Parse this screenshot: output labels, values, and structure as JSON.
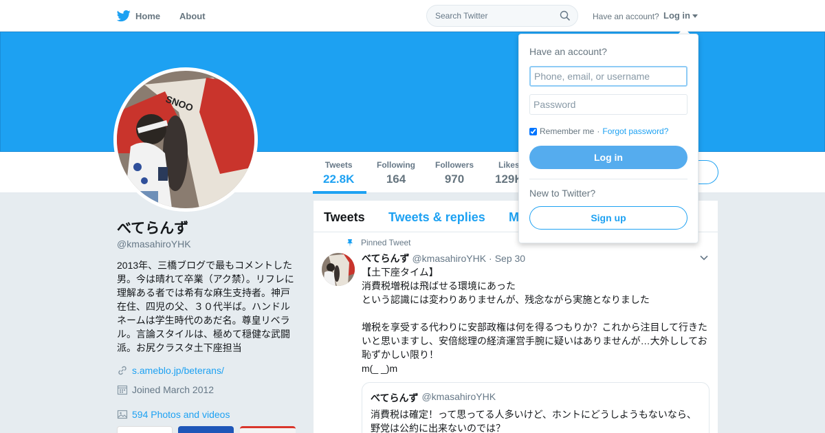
{
  "nav": {
    "home_label": "Home",
    "about_label": "About",
    "search_placeholder": "Search Twitter",
    "have_account": "Have an account?",
    "login_label": "Log in"
  },
  "stats": [
    {
      "label": "Tweets",
      "value": "22.8K"
    },
    {
      "label": "Following",
      "value": "164"
    },
    {
      "label": "Followers",
      "value": "970"
    },
    {
      "label": "Likes",
      "value": "129K"
    }
  ],
  "profile": {
    "name": "べてらんず",
    "handle": "@kmasahiroYHK",
    "bio": "2013年、三橋ブログで最もコメントした男。今は晴れて卒業（アク禁）。リフレに理解ある者では希有な麻生支持者。神戸在住、四児の父、３０代半ば。ハンドルネームは学生時代のあだ名。尊皇リベラル。言論スタイルは、極めて穏健な武闘派。お尻クラスタ土下座担当",
    "link": "s.ameblo.jp/beterans/",
    "joined": "Joined March 2012",
    "photos": "594 Photos and videos"
  },
  "timeline": {
    "tabs": [
      "Tweets",
      "Tweets & replies",
      "M"
    ],
    "pinned_label": "Pinned Tweet",
    "tweet": {
      "name": "べてらんず",
      "handle": "@kmasahiroYHK",
      "separator": "·",
      "date": "Sep 30",
      "text": "【土下座タイム】\n消費税増税は飛ばせる環境にあった\nという認識には変わりありませんが、残念ながら実施となりました\n\n増税を享受する代わりに安部政権は何を得るつもりか？これから注目して行きたいと思いますし、安倍総理の経済運営手腕に疑いはありませんが…大外ししてお恥ずかしい限り！\nm(_ _)m"
    },
    "quote": {
      "name": "べてらんず",
      "handle": "@kmasahiroYHK",
      "text": "消費税は確定！って思ってる人多いけど、ホントにどうしようもないなら、\n野党は公約に出来ないのでは？"
    }
  },
  "login_dropdown": {
    "title": "Have an account?",
    "username_placeholder": "Phone, email, or username",
    "password_placeholder": "Password",
    "remember_label": "Remember me",
    "separator": "·",
    "forgot_label": "Forgot password?",
    "login_button": "Log in",
    "new_label": "New to Twitter?",
    "signup_button": "Sign up"
  },
  "colors": {
    "accent": "#1da1f2",
    "banner": "#1da1f2",
    "background": "#e6ecf0"
  }
}
